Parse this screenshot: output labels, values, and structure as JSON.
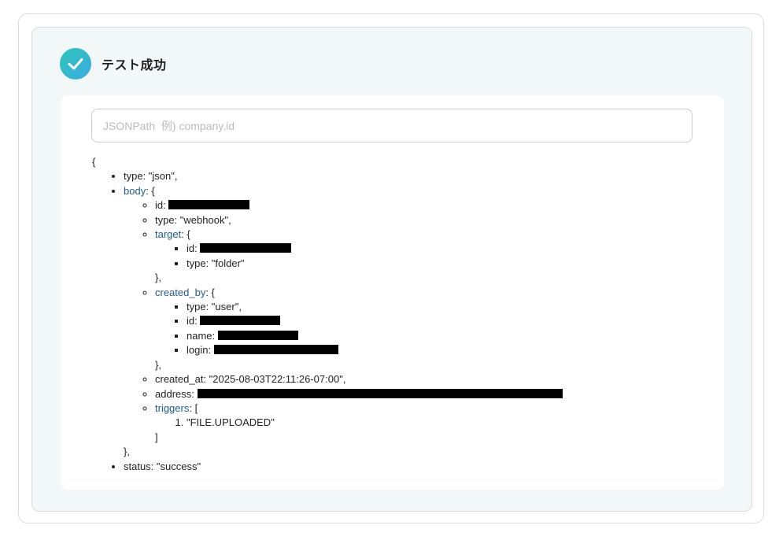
{
  "status": {
    "title": "テスト成功"
  },
  "search": {
    "placeholder": "JSONPath  例) company.id",
    "value": ""
  },
  "json": {
    "open_brace": "{",
    "type_line": "type: \"json\",",
    "body_key": "body",
    "body_open": ": {",
    "id_label": "id:",
    "body_type_line": "type: \"webhook\",",
    "target_key": "target",
    "target_open": ": {",
    "target_id_label": "id:",
    "target_type_line": "type: \"folder\"",
    "target_close": "},",
    "created_by_key": "created_by",
    "created_by_open": ": {",
    "cb_type_line": "type: \"user\",",
    "cb_id_label": "id:",
    "cb_name_label": "name:",
    "cb_login_label": "login:",
    "cb_close": "},",
    "created_at_line": "created_at: \"2025-08-03T22:11:26-07:00\",",
    "address_label": "address:",
    "triggers_key": "triggers",
    "triggers_open": ": [",
    "trigger_item": "\"FILE.UPLOADED\"",
    "triggers_close": "]",
    "body_close": "},",
    "status_line": "status: \"success\""
  }
}
